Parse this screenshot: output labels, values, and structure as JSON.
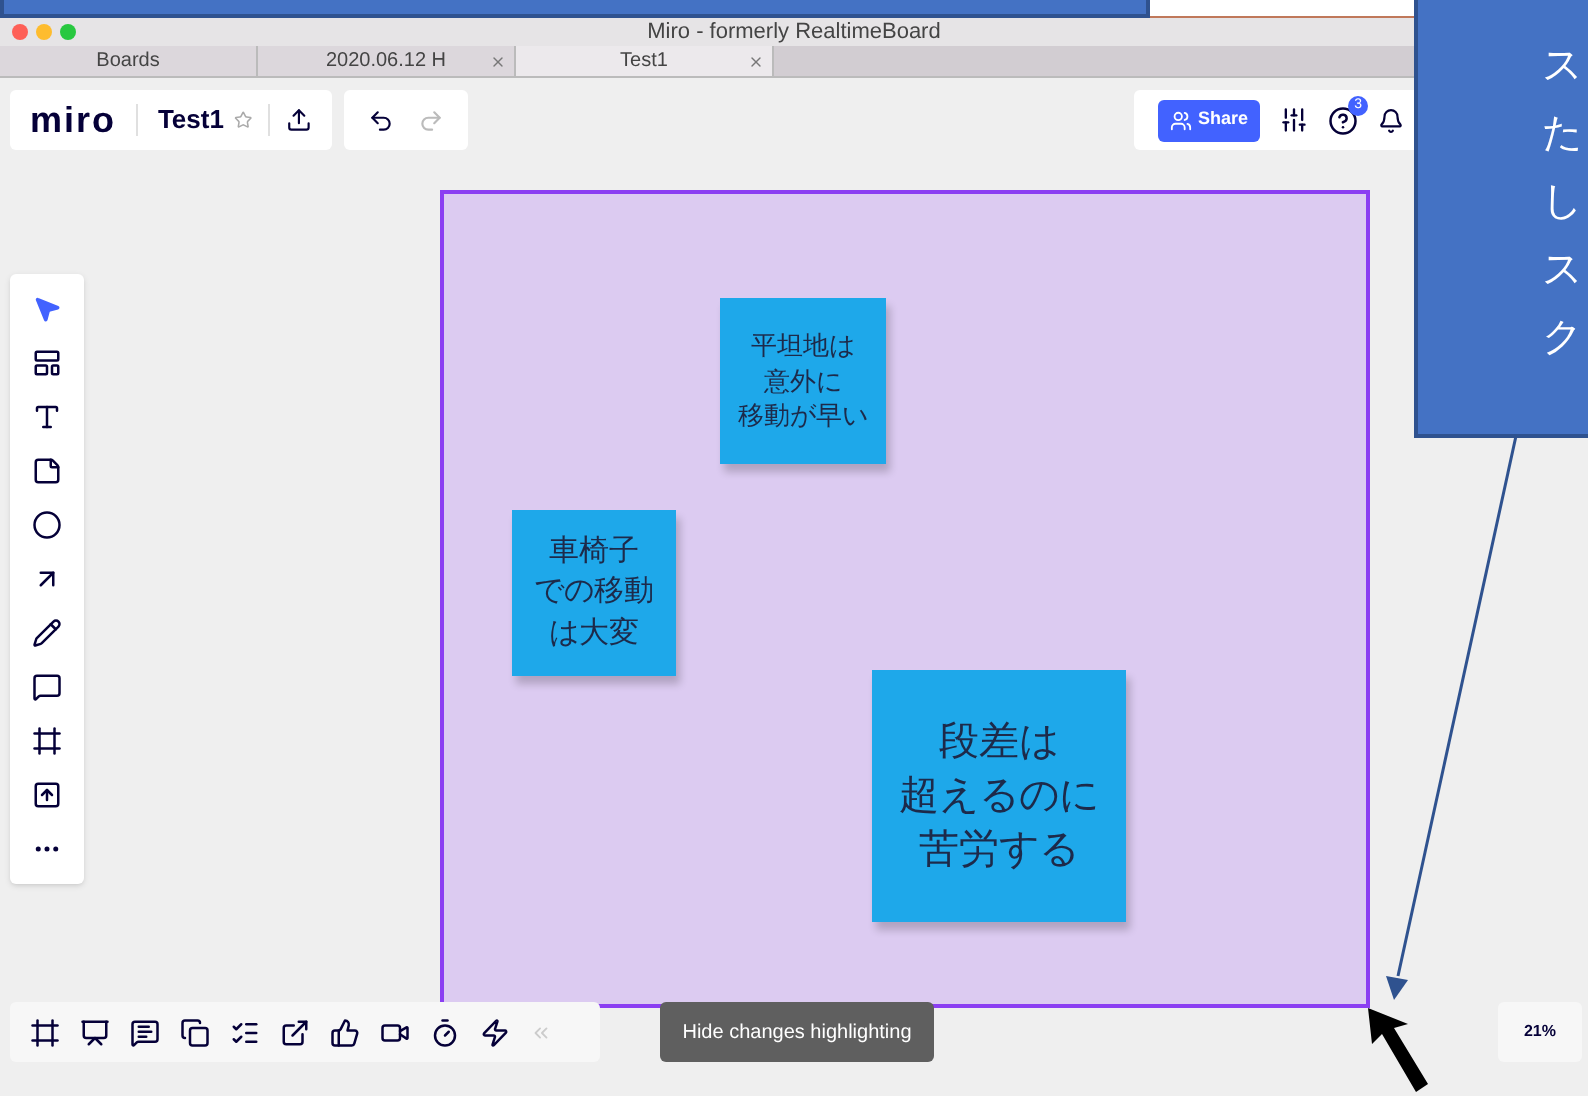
{
  "window": {
    "title": "Miro - formerly RealtimeBoard"
  },
  "browser_tabs": [
    {
      "label": "Boards",
      "selected": false,
      "closable": false
    },
    {
      "label": "2020.06.12 H",
      "selected": false,
      "closable": true
    },
    {
      "label": "Test1",
      "selected": true,
      "closable": true
    }
  ],
  "board_bar": {
    "logo": "miro",
    "board_name": "Test1",
    "starred": false
  },
  "top_right": {
    "share": "Share",
    "help_badge": "3"
  },
  "frame": {
    "notes": [
      {
        "lines": [
          "平坦地は",
          "意外に",
          "移動が早い"
        ]
      },
      {
        "lines": [
          "車椅子",
          "での移動",
          "は大変"
        ]
      },
      {
        "lines": [
          "段差は",
          "超えるのに",
          "苦労する"
        ]
      }
    ]
  },
  "tooltip": "Hide changes highlighting",
  "zoom": "21%",
  "callout": {
    "lines": [
      "ス",
      "た",
      "し",
      "ス",
      "ク"
    ]
  }
}
